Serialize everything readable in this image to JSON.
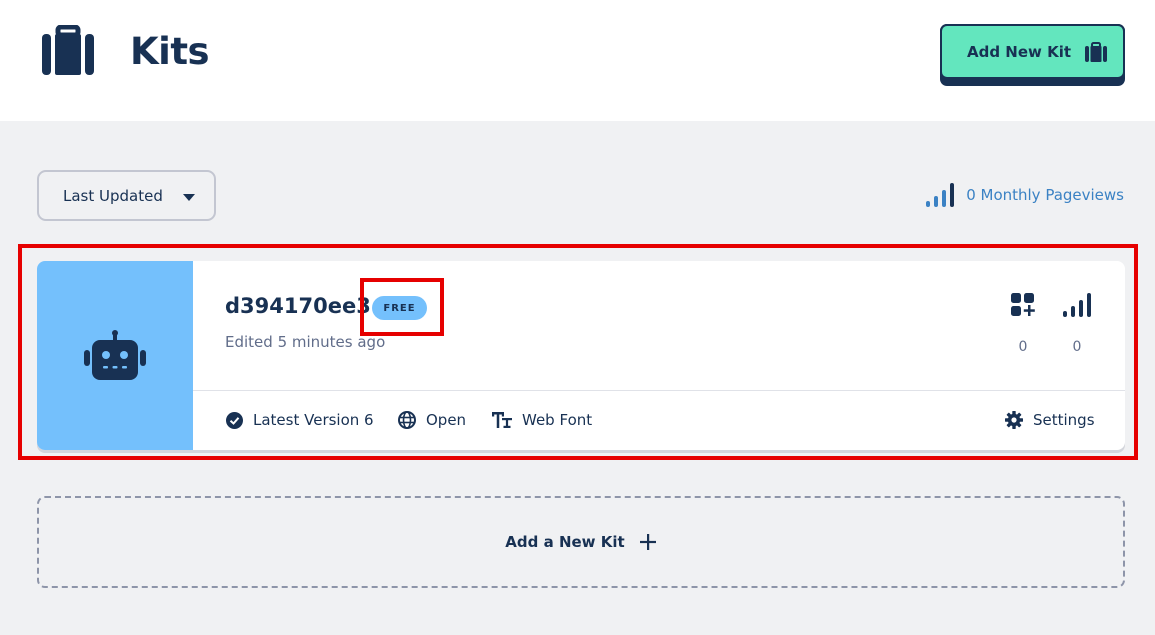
{
  "header": {
    "title": "Kits",
    "add_button_label": "Add New Kit"
  },
  "toolbar": {
    "sort_label": "Last Updated",
    "pageviews_label": "0 Monthly Pageviews"
  },
  "kit": {
    "name": "d394170ee3",
    "badge": "FREE",
    "edited": "Edited 5 minutes ago",
    "icon_count": "0",
    "pageview_count": "0",
    "version_label": "Latest Version 6",
    "access_label": "Open",
    "tech_label": "Web Font",
    "settings_label": "Settings",
    "icon": "robot-icon"
  },
  "new_kit_label": "Add a New Kit",
  "colors": {
    "navy": "#183153",
    "mint": "#63e6be",
    "sky": "#74c0fc",
    "link": "#3b82c4",
    "highlight": "#e60000"
  }
}
